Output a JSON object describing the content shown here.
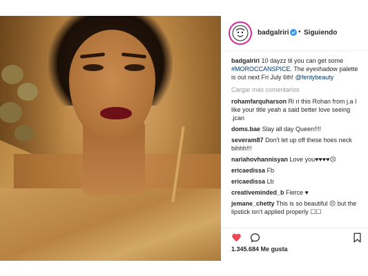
{
  "post": {
    "username": "badgalriri",
    "separator": "•",
    "follow_label": "Siguiendo",
    "caption_user": "badgalriri",
    "caption_text": "10 dayzz til you can get some",
    "caption_hashtag": "#MOROCCANSPICE",
    "caption_text2": ". The eyeshadow palette is out next Fri July 6th!",
    "caption_mention": "@fentybeauty",
    "load_more": "Cargar más comentarios",
    "likes": "1.345.684 Me gusta"
  },
  "comments": [
    {
      "user": "rohamfarquharson",
      "text": "Ri ri this Rohan from j.a I like your title yeah a said better love seeing .jcan"
    },
    {
      "user": "doms.bae",
      "text": "Slay all day Queen!!!!"
    },
    {
      "user": "severam87",
      "text": "Don't let up off these hoes neck bihhh!!!"
    },
    {
      "user": "nariahovhannisyan",
      "text": "Love you♥♥♥♥☹"
    },
    {
      "user": "ericaedissa",
      "text": "Fb"
    },
    {
      "user": "ericaedissa",
      "text": "Lb"
    },
    {
      "user": "creativeminded_b",
      "text": "Fierce ♥"
    },
    {
      "user": "jemane_chetty",
      "text": "This is so beautiful ☹ but the lipstick isn't applied properly ☐☐"
    }
  ],
  "icons": {
    "like": "heart-icon",
    "comment": "comment-icon",
    "save": "bookmark-icon",
    "verified": "verified-badge-icon",
    "avatar": "avatar-icon"
  },
  "colors": {
    "like_red": "#ed4956",
    "verified_blue": "#3897f0",
    "link": "#003569",
    "muted": "#999999"
  }
}
